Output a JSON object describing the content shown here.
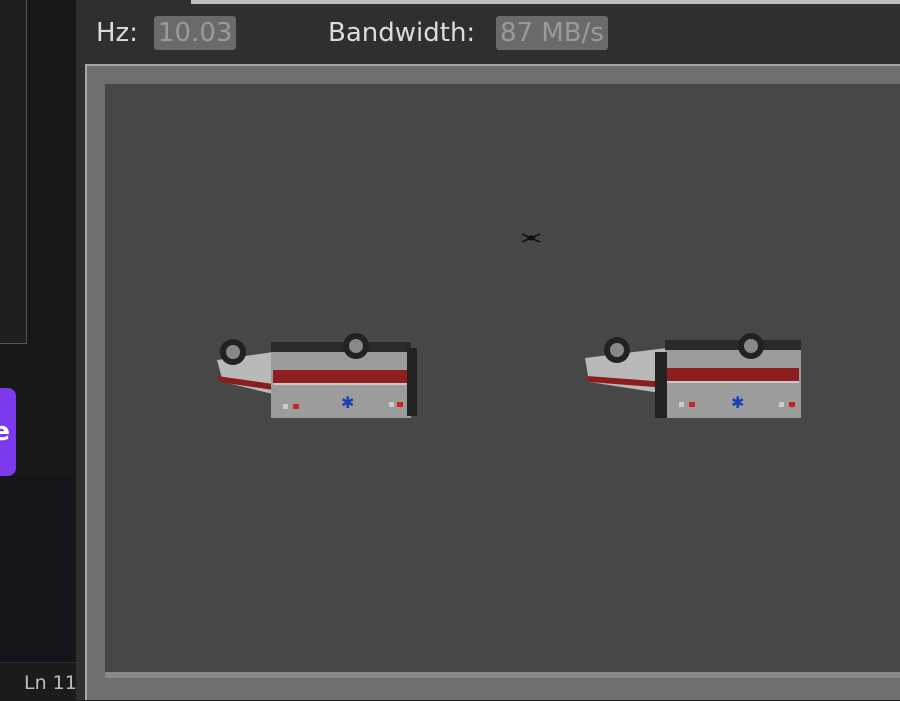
{
  "left_panel": {
    "button_label": "e",
    "status_text": "Ln 11"
  },
  "stats": {
    "hz_label": "Hz:",
    "hz_value": "10.03",
    "bandwidth_label": "Bandwidth:",
    "bandwidth_value": "87 MB/s"
  },
  "scene": {
    "objects": [
      {
        "name": "ambulance",
        "state": "overturned"
      },
      {
        "name": "ambulance",
        "state": "overturned"
      },
      {
        "name": "drone"
      }
    ]
  },
  "colors": {
    "accent_purple": "#7c3aed",
    "viewport_bg": "#474747",
    "value_chip": "#6a6a6a"
  }
}
